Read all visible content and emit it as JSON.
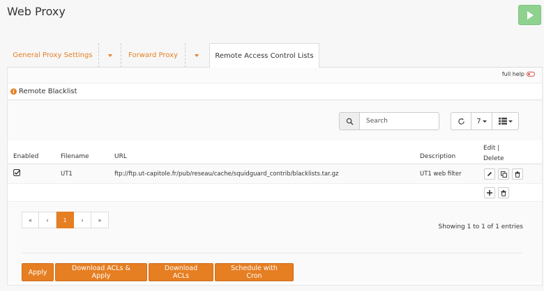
{
  "header": {
    "title": "Web Proxy"
  },
  "tabs": [
    {
      "label": "General Proxy Settings"
    },
    {
      "label": "Forward Proxy"
    },
    {
      "label": "Remote Access Control Lists"
    }
  ],
  "help": {
    "label": "full help"
  },
  "section": {
    "title": "Remote Blacklist"
  },
  "grid": {
    "search_placeholder": "Search",
    "page_size": "7",
    "columns": [
      "Enabled",
      "Filename",
      "URL",
      "Description",
      "Edit | Delete"
    ],
    "rows": [
      {
        "enabled": true,
        "filename": "UT1",
        "url": "ftp://ftp.ut-capitole.fr/pub/reseau/cache/squidguard_contrib/blacklists.tar.gz",
        "description": "UT1 web filter"
      }
    ],
    "pagination": [
      "«",
      "‹",
      "1",
      "›",
      "»"
    ],
    "active_page": "1",
    "showing": "Showing 1 to 1 of 1 entries"
  },
  "actions": {
    "apply": "Apply",
    "download_apply": "Download ACLs & Apply",
    "download": "Download ACLs",
    "schedule": "Schedule with Cron"
  },
  "colors": {
    "accent": "#e67e22",
    "play": "#8fd18f"
  },
  "icons": [
    "play-icon",
    "info-icon",
    "search-icon",
    "refresh-icon",
    "columns-icon",
    "check-icon",
    "pencil-icon",
    "copy-icon",
    "trash-icon",
    "plus-icon"
  ]
}
